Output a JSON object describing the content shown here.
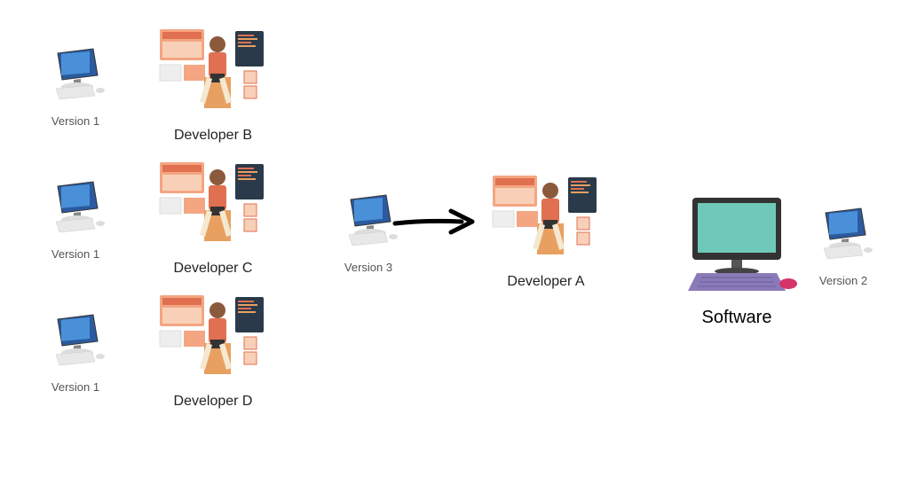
{
  "versions": {
    "v1_a": "Version 1",
    "v1_b": "Version 1",
    "v1_c": "Version 1",
    "v3": "Version 3",
    "v2": "Version 2"
  },
  "developers": {
    "b": "Developer B",
    "c": "Developer C",
    "d": "Developer D",
    "a": "Developer A"
  },
  "software": {
    "label": "Software"
  }
}
